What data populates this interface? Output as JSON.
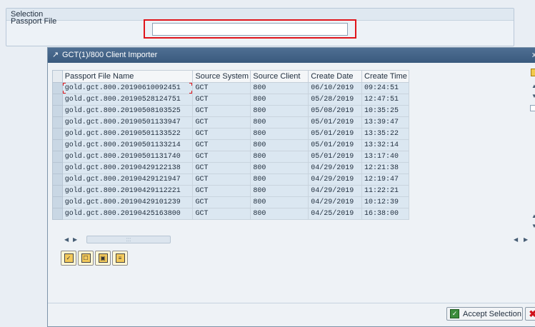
{
  "selection": {
    "title": "Selection",
    "passport_label": "Passport File",
    "passport_value": ""
  },
  "dialog": {
    "title": "GCT(1)/800 Client Importer",
    "close_glyph": "x"
  },
  "table": {
    "columns": [
      "Passport File Name",
      "Source System",
      "Source Client",
      "Create Date",
      "Create Time"
    ],
    "rows": [
      [
        "gold.gct.800.20190610092451",
        "GCT",
        "800",
        "06/10/2019",
        "09:24:51"
      ],
      [
        "gold.gct.800.20190528124751",
        "GCT",
        "800",
        "05/28/2019",
        "12:47:51"
      ],
      [
        "gold.gct.800.20190508103525",
        "GCT",
        "800",
        "05/08/2019",
        "10:35:25"
      ],
      [
        "gold.gct.800.20190501133947",
        "GCT",
        "800",
        "05/01/2019",
        "13:39:47"
      ],
      [
        "gold.gct.800.20190501133522",
        "GCT",
        "800",
        "05/01/2019",
        "13:35:22"
      ],
      [
        "gold.gct.800.20190501133214",
        "GCT",
        "800",
        "05/01/2019",
        "13:32:14"
      ],
      [
        "gold.gct.800.20190501131740",
        "GCT",
        "800",
        "05/01/2019",
        "13:17:40"
      ],
      [
        "gold.gct.800.20190429122138",
        "GCT",
        "800",
        "04/29/2019",
        "12:21:38"
      ],
      [
        "gold.gct.800.20190429121947",
        "GCT",
        "800",
        "04/29/2019",
        "12:19:47"
      ],
      [
        "gold.gct.800.20190429112221",
        "GCT",
        "800",
        "04/29/2019",
        "11:22:21"
      ],
      [
        "gold.gct.800.20190429101239",
        "GCT",
        "800",
        "04/29/2019",
        "10:12:39"
      ],
      [
        "gold.gct.800.20190425163800",
        "GCT",
        "800",
        "04/25/2019",
        "16:38:00"
      ]
    ]
  },
  "footer": {
    "accept_label": "Accept Selection"
  },
  "icons": {
    "dialog_icon": "dialog-window-icon",
    "toolbar": [
      "select-all-icon",
      "deselect-all-icon",
      "select-block-icon",
      "details-icon"
    ],
    "accept": "accept-check-icon",
    "cancel": "cancel-x-icon"
  },
  "colors": {
    "highlight": "#e0151b",
    "titlebar": "#3a5a7e",
    "row_bg": "#dbe7f1"
  }
}
